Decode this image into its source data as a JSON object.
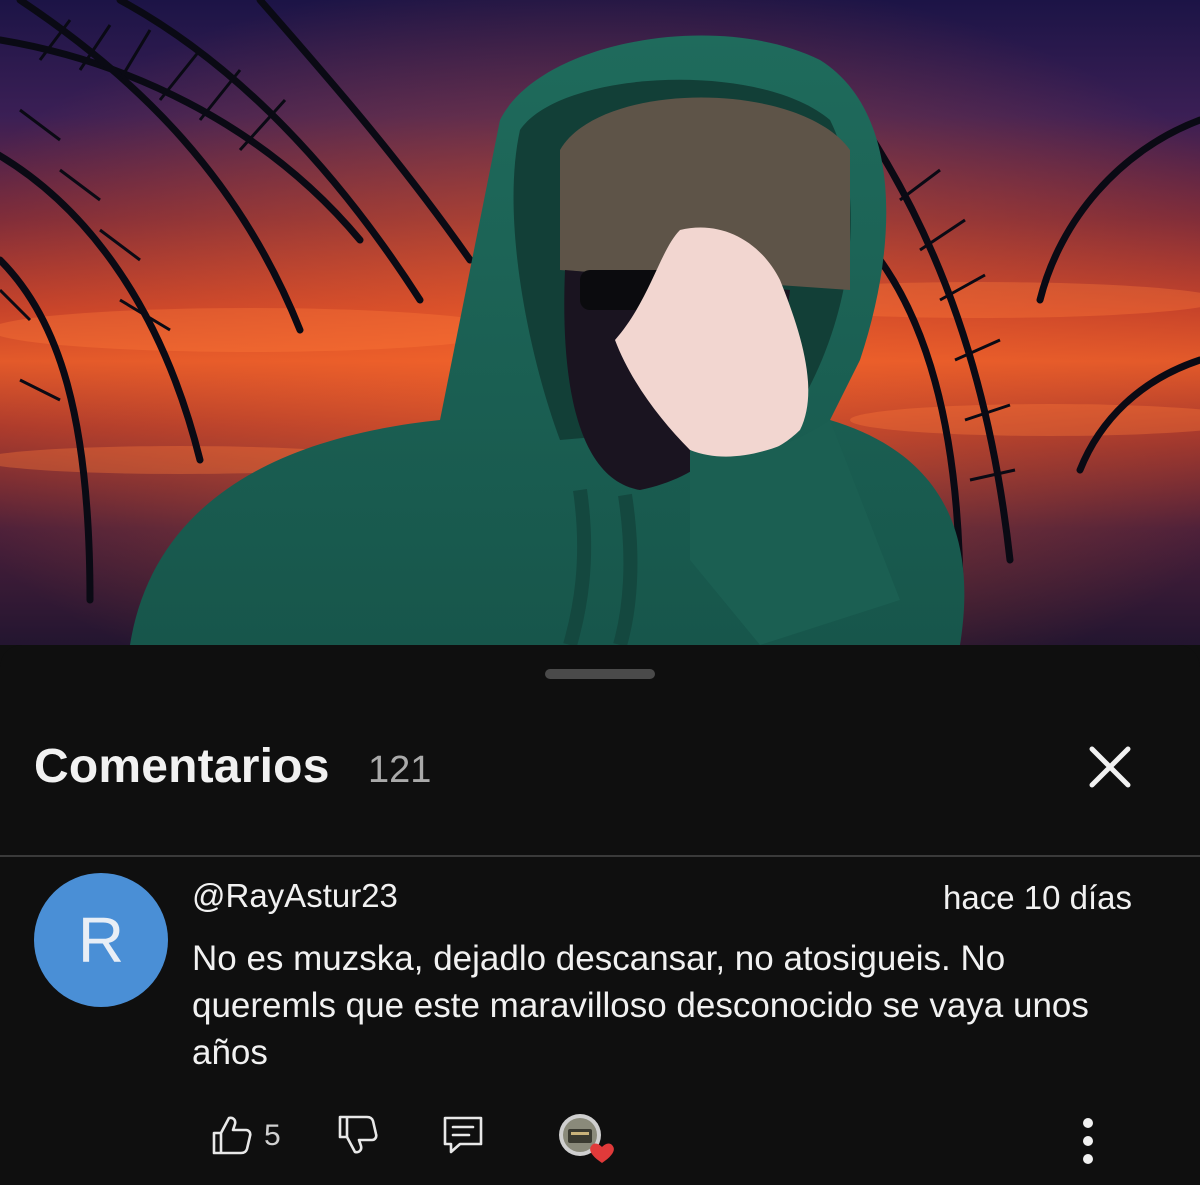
{
  "comments_panel": {
    "title": "Comentarios",
    "count": "121",
    "close_icon": "close-icon"
  },
  "comment": {
    "avatar_letter": "R",
    "avatar_color": "#4a8fd6",
    "author": "@RayAstur23",
    "timestamp": "hace 10 días",
    "text": "No es muzska, dejadlo descansar, no atosigueis. No queremls que este maravilloso desconocido se vaya unos años",
    "likes": "5",
    "icons": [
      "thumbs-up-icon",
      "thumbs-down-icon",
      "reply-icon",
      "creator-heart-icon",
      "more-vertical-icon"
    ]
  },
  "colors": {
    "background": "#0f0f0f",
    "text": "#f1f1f1",
    "secondary_text": "#aaaaaa",
    "heart": "#e03a3a"
  }
}
